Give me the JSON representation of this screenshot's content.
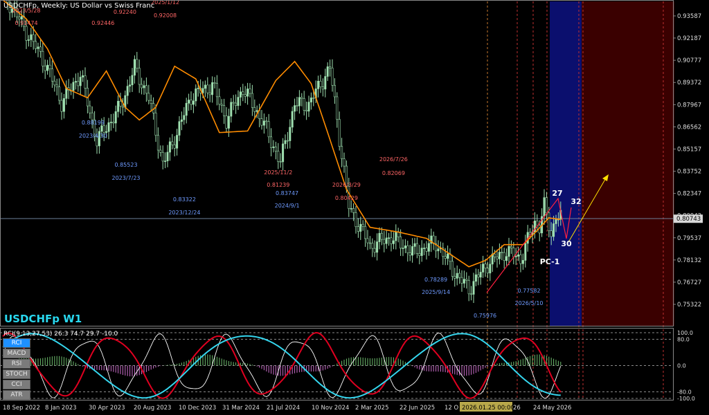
{
  "header": {
    "title": "USDCHFp, Weekly: US Dollar vs Swiss Franc"
  },
  "symbol_label": "USDCHFp W1",
  "indicator": {
    "header": "RCI(9,13,27,53) 26.3 74.7 29.7 -10.0",
    "buttons": [
      "RCI",
      "MACD",
      "RSI",
      "STOCH",
      "CCI",
      "ATR"
    ],
    "levels": [
      "100.0",
      "80.0",
      "0.0",
      "-80.0",
      "-100.0"
    ]
  },
  "colors": {
    "bull": "#9fe0b0",
    "ma": "#ff8c00",
    "high_label": "#ff6666",
    "low_label": "#6f9bff",
    "rci_white": "#ffffff",
    "rci_red": "#e00020",
    "rci_cyan": "#35d6ee"
  },
  "chart_data": {
    "type": "candlestick",
    "timeframe": "Weekly",
    "price_axis": [
      "0.93587",
      "0.92187",
      "0.90777",
      "0.89372",
      "0.87967",
      "0.86562",
      "0.85157",
      "0.83752",
      "0.82347",
      "0.80942",
      "0.79537",
      "0.78132",
      "0.76727",
      "0.75322"
    ],
    "current_price": "0.80743",
    "time_axis": [
      "18 Sep 2022",
      "8 Jan 2023",
      "30 Apr 2023",
      "20 Aug 2023",
      "10 Dec 2023",
      "31 Mar 2024",
      "21 Jul 2024",
      "10 Nov 2024",
      "2 Mar 2025",
      "22 Jun 2025",
      "12 O",
      "2026.01.25 00:00",
      "26",
      "24 May 2026"
    ],
    "price_path": [
      [
        0,
        0.951
      ],
      [
        10,
        0.926
      ],
      [
        18,
        0.906
      ],
      [
        25,
        0.881
      ],
      [
        33,
        0.899
      ],
      [
        40,
        0.857
      ],
      [
        50,
        0.878
      ],
      [
        56,
        0.903
      ],
      [
        62,
        0.884
      ],
      [
        68,
        0.842
      ],
      [
        73,
        0.858
      ],
      [
        80,
        0.885
      ],
      [
        89,
        0.892
      ],
      [
        95,
        0.87
      ],
      [
        102,
        0.89
      ],
      [
        110,
        0.87
      ],
      [
        118,
        0.843
      ],
      [
        124,
        0.88
      ],
      [
        130,
        0.88
      ],
      [
        139,
        0.903
      ],
      [
        147,
        0.815
      ],
      [
        156,
        0.79
      ],
      [
        165,
        0.796
      ],
      [
        174,
        0.786
      ],
      [
        184,
        0.792
      ],
      [
        193,
        0.771
      ],
      [
        198,
        0.763
      ],
      [
        206,
        0.779
      ],
      [
        214,
        0.787
      ],
      [
        220,
        0.782
      ],
      [
        226,
        0.805
      ],
      [
        228,
        0.803
      ],
      [
        230,
        0.815
      ],
      [
        233,
        0.797
      ],
      [
        235,
        0.81
      ],
      [
        237,
        0.808
      ]
    ],
    "ma_path": [
      [
        0,
        0.946
      ],
      [
        10,
        0.934
      ],
      [
        19,
        0.915
      ],
      [
        27,
        0.89
      ],
      [
        36,
        0.884
      ],
      [
        44,
        0.901
      ],
      [
        52,
        0.878
      ],
      [
        58,
        0.87
      ],
      [
        65,
        0.878
      ],
      [
        73,
        0.904
      ],
      [
        82,
        0.896
      ],
      [
        92,
        0.862
      ],
      [
        104,
        0.863
      ],
      [
        116,
        0.895
      ],
      [
        124,
        0.907
      ],
      [
        131,
        0.893
      ],
      [
        138,
        0.862
      ],
      [
        146,
        0.826
      ],
      [
        156,
        0.802
      ],
      [
        168,
        0.799
      ],
      [
        180,
        0.795
      ],
      [
        190,
        0.785
      ],
      [
        198,
        0.777
      ],
      [
        205,
        0.781
      ],
      [
        213,
        0.791
      ],
      [
        221,
        0.791
      ],
      [
        227,
        0.8
      ],
      [
        232,
        0.808
      ],
      [
        237,
        0.807
      ]
    ],
    "high_labels": [
      {
        "date": "2023/5/28",
        "price": "0.91474",
        "w": 10
      },
      {
        "date": "",
        "price": "0.92446",
        "w": 22
      },
      {
        "date": "",
        "price": "0.92240",
        "w": 46
      },
      {
        "date": "2025/1/12",
        "price": "0.92008",
        "w": 69
      },
      {
        "date": "2025/11/2",
        "price": "0.81239",
        "w": 117
      },
      {
        "date": "2026/3/29",
        "price": "0.80429",
        "w": 146
      },
      {
        "date": "2026/7/26",
        "price": "0.82069",
        "w": 166
      }
    ],
    "low_labels": [
      {
        "date": "2023/4/30",
        "price": "0.88199",
        "w": 6
      },
      {
        "date": "2023/7/23",
        "price": "0.85523",
        "w": 20
      },
      {
        "date": "2023/12/24",
        "price": "0.83322",
        "w": 36
      },
      {
        "date": "2024/9/1",
        "price": "0.83747",
        "w": 59
      },
      {
        "date": "2025/9/14",
        "price": "0.78289",
        "w": 109
      },
      {
        "date": "2026/5/10",
        "price": "0.77582",
        "w": 150
      },
      {
        "date": "",
        "price": "0.75976",
        "w": 124
      }
    ],
    "wave_labels": [
      "27",
      "32",
      "30",
      "PC-1"
    ]
  }
}
